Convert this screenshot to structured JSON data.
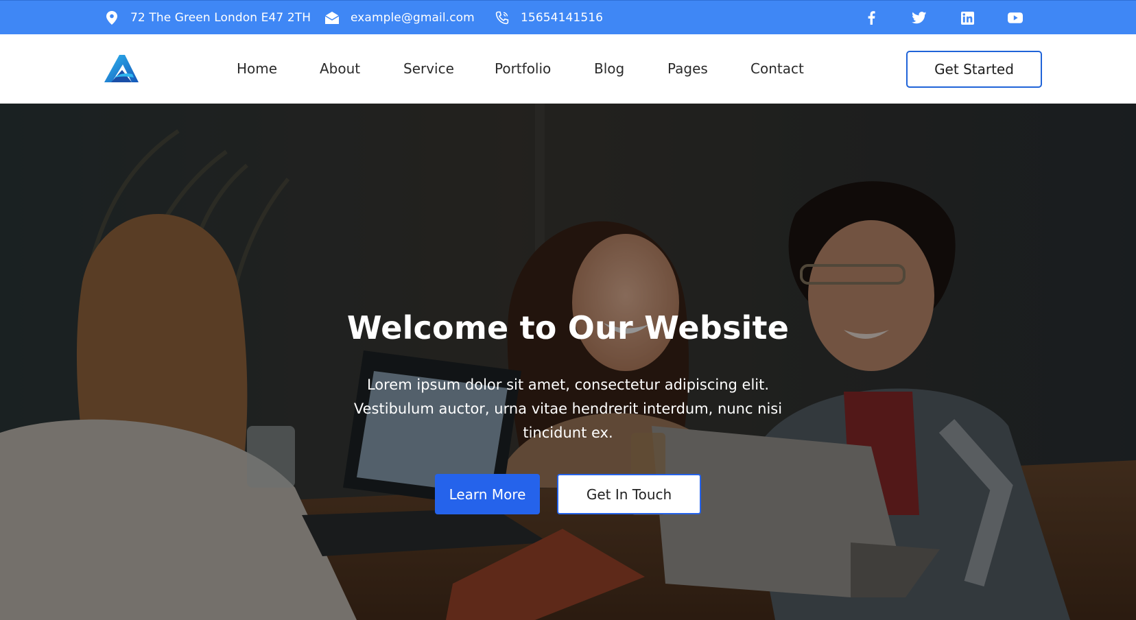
{
  "topbar": {
    "background": "#3f87f5",
    "address": {
      "icon": "map-pin-icon",
      "text": "72 The Green London E47 2TH"
    },
    "email": {
      "icon": "envelope-icon",
      "text": "example@gmail.com"
    },
    "phone": {
      "icon": "phone-icon",
      "text": "15654141516"
    },
    "social": [
      {
        "icon": "facebook-icon"
      },
      {
        "icon": "twitter-icon"
      },
      {
        "icon": "linkedin-icon"
      },
      {
        "icon": "youtube-icon"
      }
    ]
  },
  "header": {
    "logo": "logo-icon",
    "nav": [
      "Home",
      "About",
      "Service",
      "Portfolio",
      "Blog",
      "Pages",
      "Contact"
    ],
    "cta_label": "Get Started",
    "accent": "#1f63d8"
  },
  "hero": {
    "title": "Welcome to Our Website",
    "text": "Lorem ipsum dolor sit amet, consectetur adipiscing elit. Vestibulum auctor, urna vitae hendrerit interdum, nunc nisi tincidunt ex.",
    "primary_button": "Learn More",
    "secondary_button": "Get In Touch",
    "primary_color": "#2563eb"
  }
}
